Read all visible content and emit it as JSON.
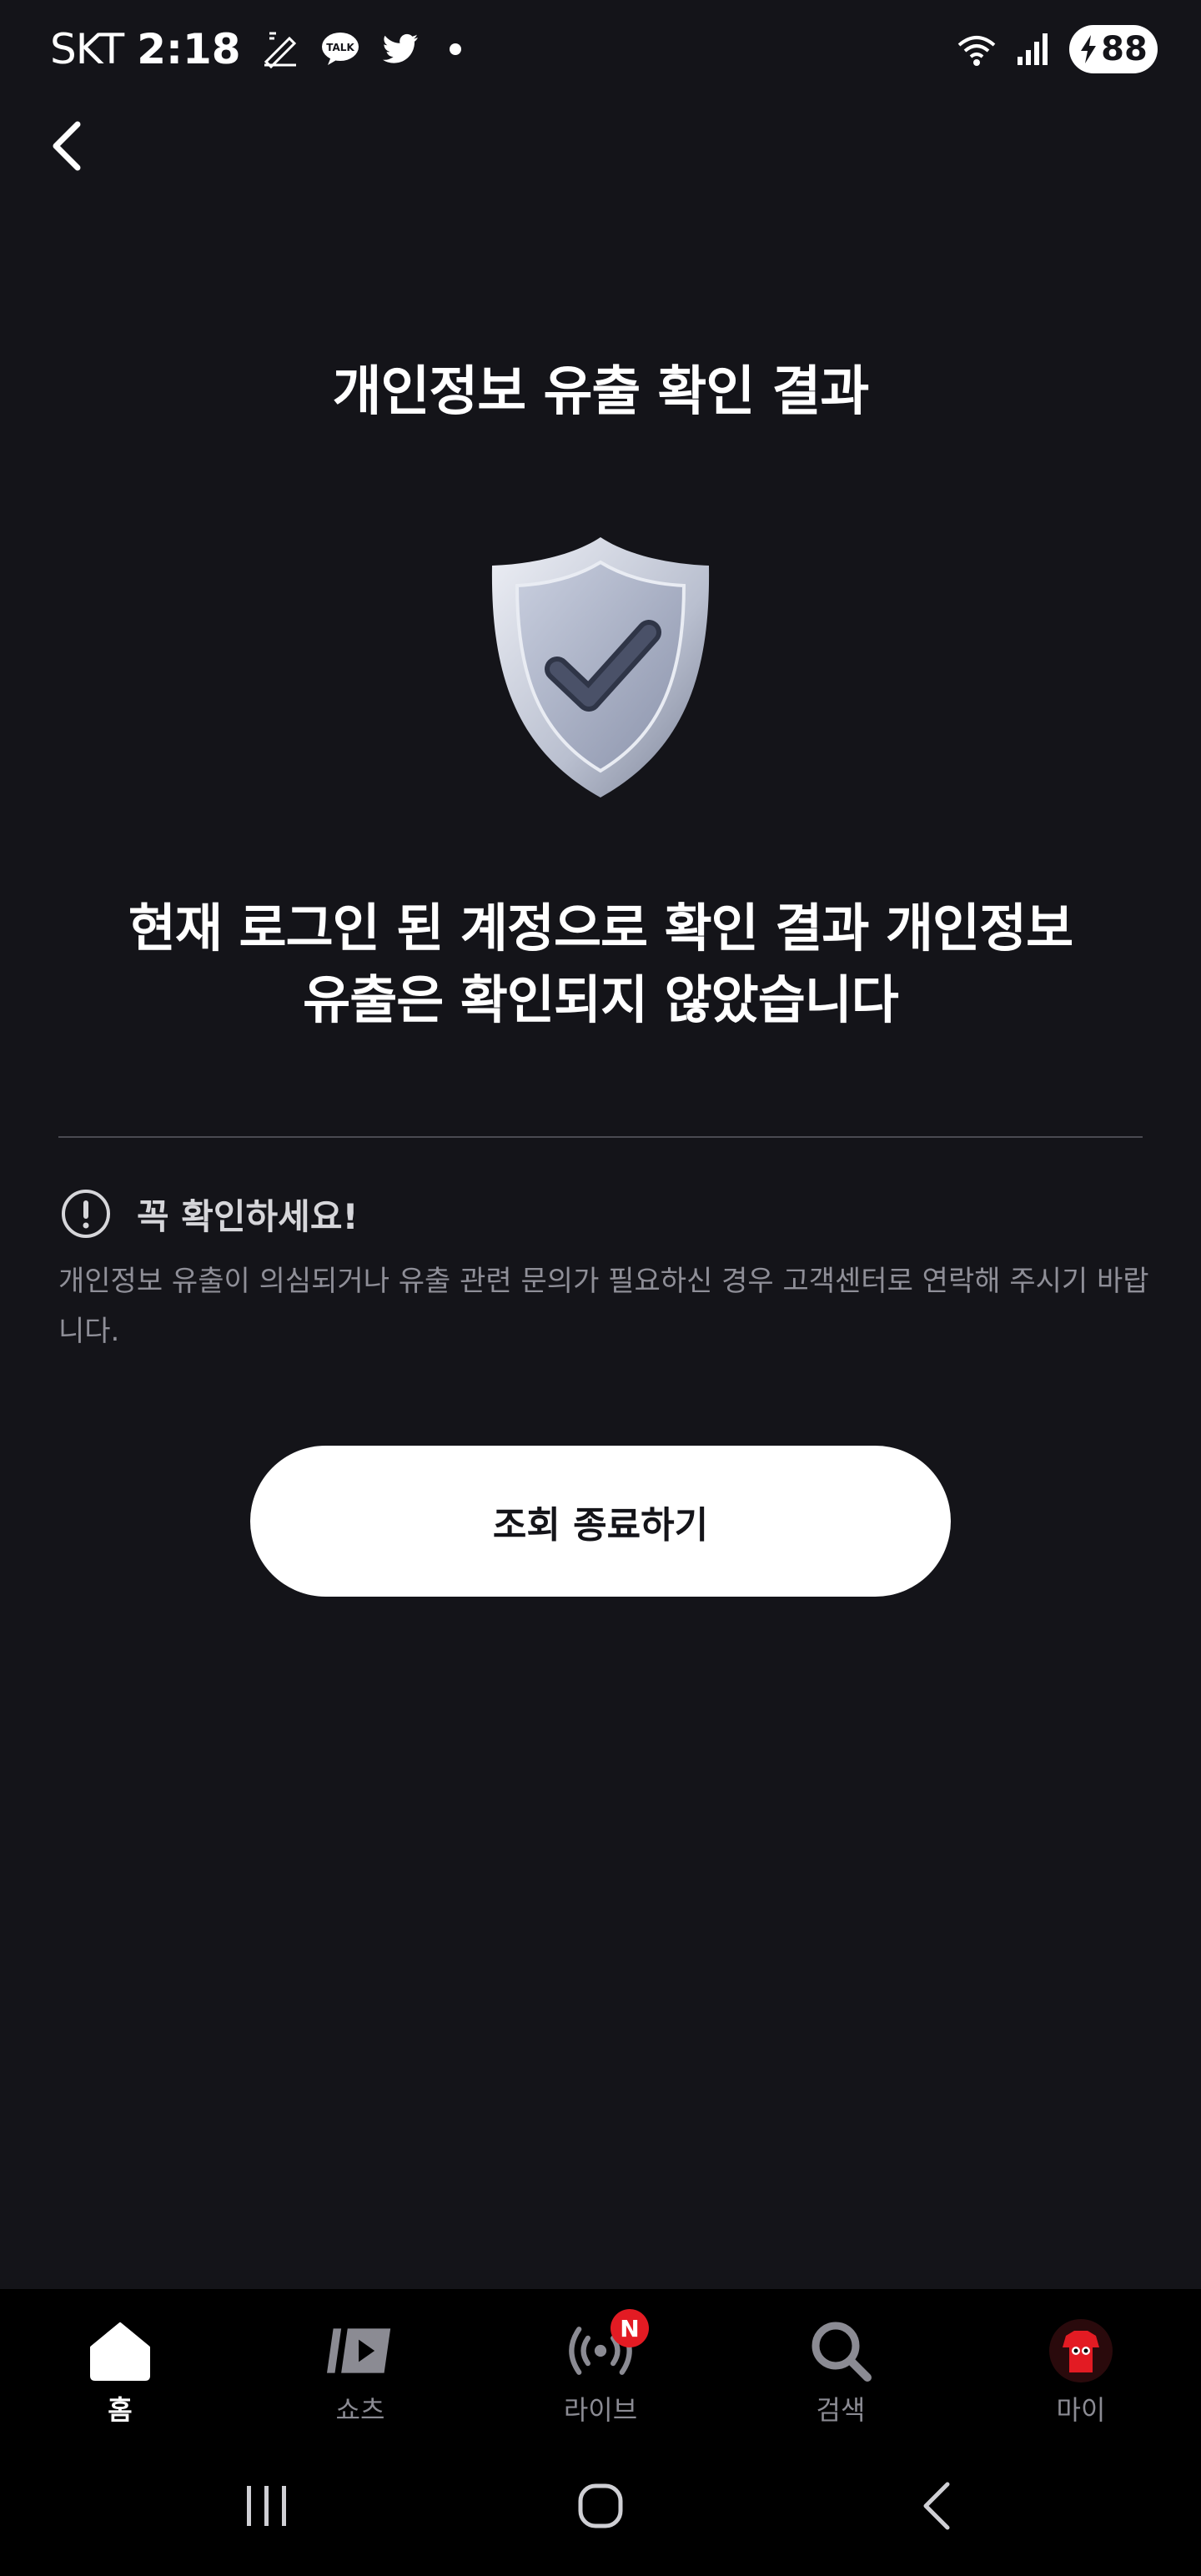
{
  "status_bar": {
    "carrier": "SKT",
    "time": "2:18",
    "battery_level": "88",
    "notification_icons": [
      "edit-icon",
      "kakaotalk-icon",
      "twitter-icon",
      "dot-icon"
    ]
  },
  "header": {
    "back_icon": "chevron-left-icon"
  },
  "page": {
    "title": "개인정보 유출 확인 결과",
    "shield_icon": "shield-check-icon",
    "result_line1": "현재 로그인 된 계정으로 확인 결과 개인정보",
    "result_line2": "유출은 확인되지 않았습니다",
    "notice_title": "꼭 확인하세요!",
    "notice_body": "개인정보 유출이 의심되거나 유출 관련 문의가 필요하신 경우 고객센터로 연락해 주시기 바랍니다.",
    "end_button_label": "조회 종료하기"
  },
  "bottom_nav": {
    "items": [
      {
        "label": "홈",
        "icon": "home-icon",
        "active": true
      },
      {
        "label": "쇼츠",
        "icon": "shorts-icon",
        "active": false
      },
      {
        "label": "라이브",
        "icon": "live-icon",
        "active": false,
        "badge": "N"
      },
      {
        "label": "검색",
        "icon": "search-icon",
        "active": false
      },
      {
        "label": "마이",
        "icon": "avatar-icon",
        "active": false
      }
    ]
  },
  "colors": {
    "background": "#141419",
    "text": "#ffffff",
    "muted_text": "#8f8f98",
    "button_bg": "#ffffff",
    "badge": "#e31b23"
  }
}
